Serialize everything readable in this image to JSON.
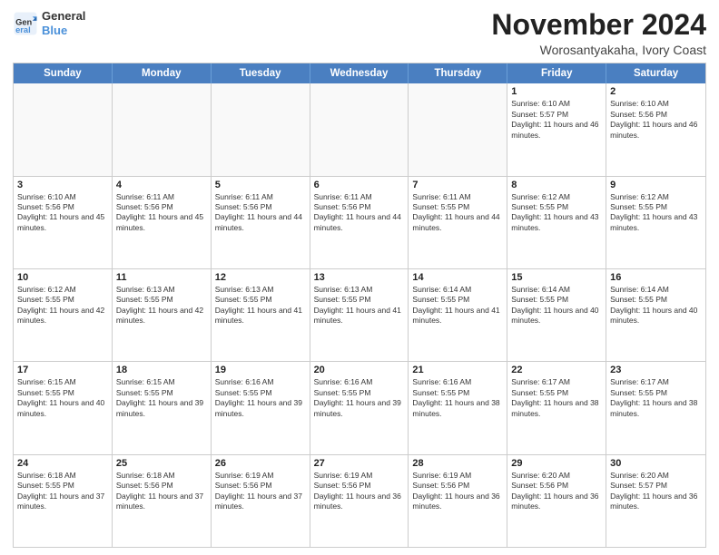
{
  "header": {
    "logo_line1": "General",
    "logo_line2": "Blue",
    "month_title": "November 2024",
    "location": "Worosantyakaha, Ivory Coast"
  },
  "weekdays": [
    "Sunday",
    "Monday",
    "Tuesday",
    "Wednesday",
    "Thursday",
    "Friday",
    "Saturday"
  ],
  "rows": [
    [
      {
        "day": "",
        "empty": true
      },
      {
        "day": "",
        "empty": true
      },
      {
        "day": "",
        "empty": true
      },
      {
        "day": "",
        "empty": true
      },
      {
        "day": "",
        "empty": true
      },
      {
        "day": "1",
        "sunrise": "6:10 AM",
        "sunset": "5:57 PM",
        "daylight": "11 hours and 46 minutes."
      },
      {
        "day": "2",
        "sunrise": "6:10 AM",
        "sunset": "5:56 PM",
        "daylight": "11 hours and 46 minutes."
      }
    ],
    [
      {
        "day": "3",
        "sunrise": "6:10 AM",
        "sunset": "5:56 PM",
        "daylight": "11 hours and 45 minutes."
      },
      {
        "day": "4",
        "sunrise": "6:11 AM",
        "sunset": "5:56 PM",
        "daylight": "11 hours and 45 minutes."
      },
      {
        "day": "5",
        "sunrise": "6:11 AM",
        "sunset": "5:56 PM",
        "daylight": "11 hours and 44 minutes."
      },
      {
        "day": "6",
        "sunrise": "6:11 AM",
        "sunset": "5:56 PM",
        "daylight": "11 hours and 44 minutes."
      },
      {
        "day": "7",
        "sunrise": "6:11 AM",
        "sunset": "5:55 PM",
        "daylight": "11 hours and 44 minutes."
      },
      {
        "day": "8",
        "sunrise": "6:12 AM",
        "sunset": "5:55 PM",
        "daylight": "11 hours and 43 minutes."
      },
      {
        "day": "9",
        "sunrise": "6:12 AM",
        "sunset": "5:55 PM",
        "daylight": "11 hours and 43 minutes."
      }
    ],
    [
      {
        "day": "10",
        "sunrise": "6:12 AM",
        "sunset": "5:55 PM",
        "daylight": "11 hours and 42 minutes."
      },
      {
        "day": "11",
        "sunrise": "6:13 AM",
        "sunset": "5:55 PM",
        "daylight": "11 hours and 42 minutes."
      },
      {
        "day": "12",
        "sunrise": "6:13 AM",
        "sunset": "5:55 PM",
        "daylight": "11 hours and 41 minutes."
      },
      {
        "day": "13",
        "sunrise": "6:13 AM",
        "sunset": "5:55 PM",
        "daylight": "11 hours and 41 minutes."
      },
      {
        "day": "14",
        "sunrise": "6:14 AM",
        "sunset": "5:55 PM",
        "daylight": "11 hours and 41 minutes."
      },
      {
        "day": "15",
        "sunrise": "6:14 AM",
        "sunset": "5:55 PM",
        "daylight": "11 hours and 40 minutes."
      },
      {
        "day": "16",
        "sunrise": "6:14 AM",
        "sunset": "5:55 PM",
        "daylight": "11 hours and 40 minutes."
      }
    ],
    [
      {
        "day": "17",
        "sunrise": "6:15 AM",
        "sunset": "5:55 PM",
        "daylight": "11 hours and 40 minutes."
      },
      {
        "day": "18",
        "sunrise": "6:15 AM",
        "sunset": "5:55 PM",
        "daylight": "11 hours and 39 minutes."
      },
      {
        "day": "19",
        "sunrise": "6:16 AM",
        "sunset": "5:55 PM",
        "daylight": "11 hours and 39 minutes."
      },
      {
        "day": "20",
        "sunrise": "6:16 AM",
        "sunset": "5:55 PM",
        "daylight": "11 hours and 39 minutes."
      },
      {
        "day": "21",
        "sunrise": "6:16 AM",
        "sunset": "5:55 PM",
        "daylight": "11 hours and 38 minutes."
      },
      {
        "day": "22",
        "sunrise": "6:17 AM",
        "sunset": "5:55 PM",
        "daylight": "11 hours and 38 minutes."
      },
      {
        "day": "23",
        "sunrise": "6:17 AM",
        "sunset": "5:55 PM",
        "daylight": "11 hours and 38 minutes."
      }
    ],
    [
      {
        "day": "24",
        "sunrise": "6:18 AM",
        "sunset": "5:55 PM",
        "daylight": "11 hours and 37 minutes."
      },
      {
        "day": "25",
        "sunrise": "6:18 AM",
        "sunset": "5:56 PM",
        "daylight": "11 hours and 37 minutes."
      },
      {
        "day": "26",
        "sunrise": "6:19 AM",
        "sunset": "5:56 PM",
        "daylight": "11 hours and 37 minutes."
      },
      {
        "day": "27",
        "sunrise": "6:19 AM",
        "sunset": "5:56 PM",
        "daylight": "11 hours and 36 minutes."
      },
      {
        "day": "28",
        "sunrise": "6:19 AM",
        "sunset": "5:56 PM",
        "daylight": "11 hours and 36 minutes."
      },
      {
        "day": "29",
        "sunrise": "6:20 AM",
        "sunset": "5:56 PM",
        "daylight": "11 hours and 36 minutes."
      },
      {
        "day": "30",
        "sunrise": "6:20 AM",
        "sunset": "5:57 PM",
        "daylight": "11 hours and 36 minutes."
      }
    ]
  ]
}
